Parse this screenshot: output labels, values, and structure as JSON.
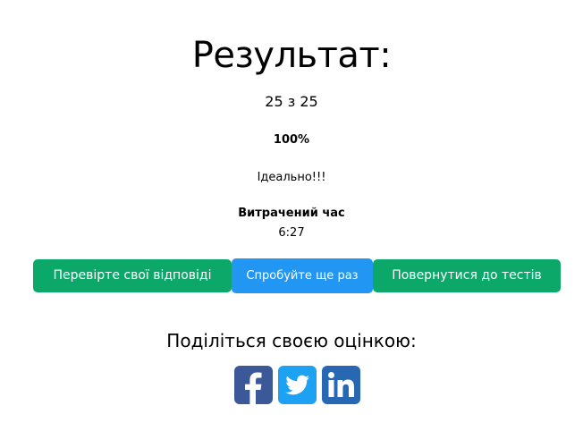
{
  "result": {
    "title": "Результат:",
    "score": "25 з 25",
    "percent": "100%",
    "verdict": "Ідеально!!!",
    "time_label": "Витрачений час",
    "time_value": "6:27"
  },
  "buttons": {
    "check_answers": "Перевірте свої відповіді",
    "try_again": "Спробуйте ще раз",
    "back_to_tests": "Повернутися до тестів"
  },
  "share": {
    "title": "Поділіться своєю оцінкою:",
    "icons": [
      "facebook-icon",
      "twitter-icon",
      "linkedin-icon"
    ]
  },
  "colors": {
    "green": "#0ca86a",
    "blue": "#2196f3",
    "facebook": "#3b5998",
    "twitter": "#1da1f2",
    "linkedin": "#2867b2"
  }
}
